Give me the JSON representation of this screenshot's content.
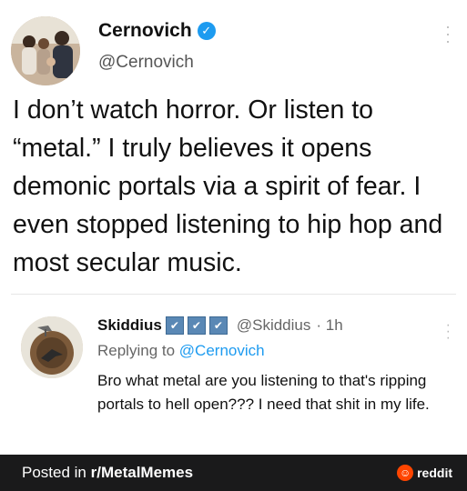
{
  "tweet": {
    "display_name": "Cernovich",
    "handle": "@Cernovich",
    "verified_icon": "check",
    "text": "I don’t watch horror. Or listen to “metal.” I truly believes it opens demonic portals via a spirit of fear. I even stopped listening to hip hop and most secular music."
  },
  "reply": {
    "display_name": "Skiddius",
    "badges": [
      "✔",
      "✔",
      "✔"
    ],
    "handle": "@Skiddius",
    "time": "· 1h",
    "replying_label": "Replying to",
    "replying_to": "@Cernovich",
    "text": "Bro what metal are you listening to that's ripping portals to hell open??? I need that shit in my life."
  },
  "footer": {
    "posted_prefix": "Posted in",
    "subreddit": "r/MetalMemes",
    "brand": "reddit"
  },
  "colors": {
    "verified": "#1d9bf0",
    "link": "#1d9bf0",
    "footer_bg": "#1a1a1b",
    "reddit_orange": "#ff4500",
    "badge": "#5a88b5"
  }
}
